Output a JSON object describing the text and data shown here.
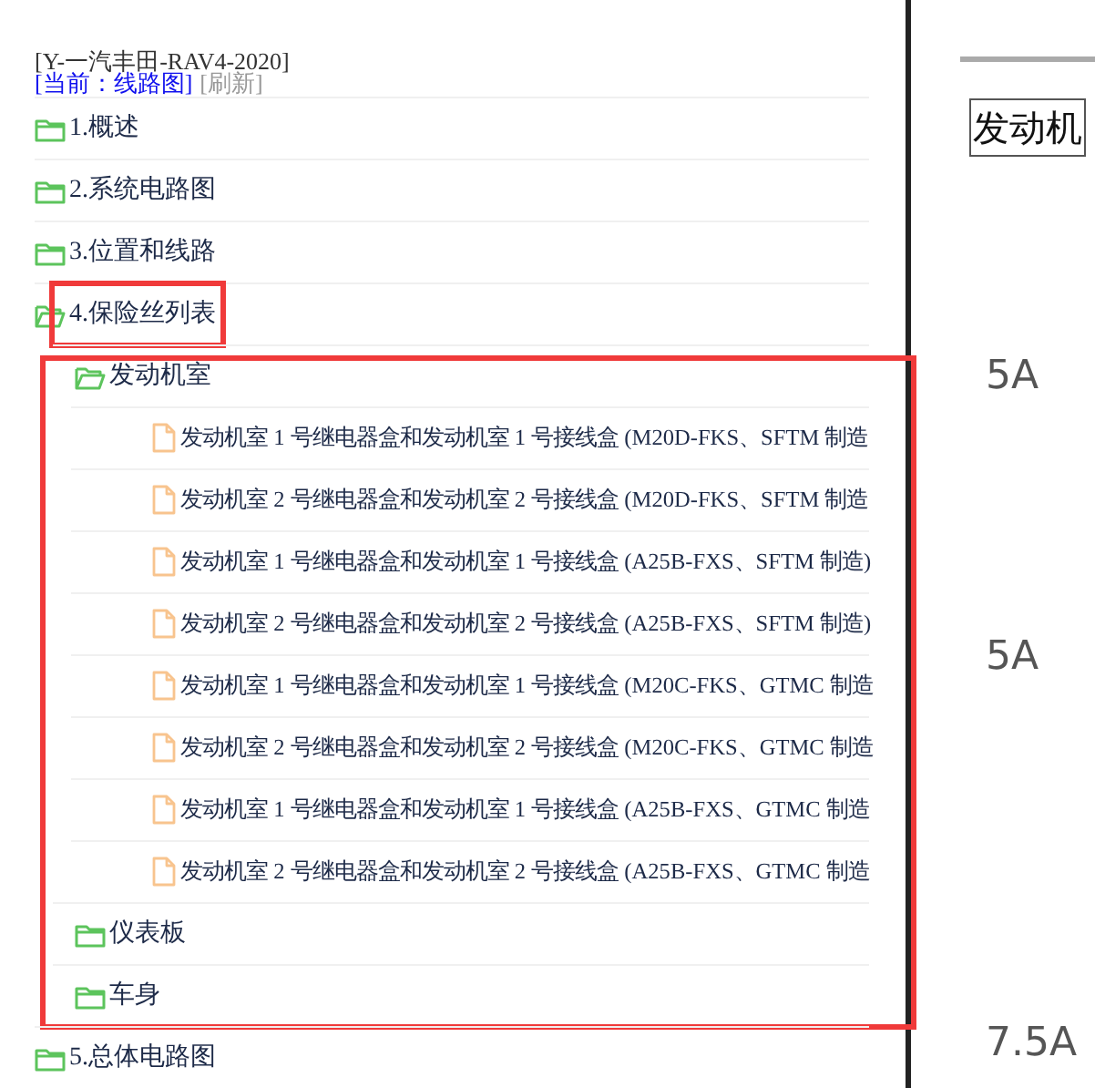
{
  "header": {
    "title": "[Y-一汽丰田-RAV4-2020]",
    "current": "[当前：线路图]",
    "refresh": "[刷新]"
  },
  "tree": [
    {
      "label": "1.概述",
      "kind": "folder",
      "expanded": false,
      "highlighted": false
    },
    {
      "label": "2.系统电路图",
      "kind": "folder",
      "expanded": false,
      "highlighted": false
    },
    {
      "label": "3.位置和线路",
      "kind": "folder",
      "expanded": false,
      "highlighted": false
    },
    {
      "label": "4.保险丝列表",
      "kind": "folder",
      "expanded": true,
      "highlighted": true,
      "children": [
        {
          "label": "发动机室",
          "kind": "folder",
          "expanded": true,
          "highlighted": false,
          "children": [
            {
              "label": "发动机室 1 号继电器盒和发动机室 1 号接线盒 (M20D-FKS、SFTM 制造",
              "kind": "file"
            },
            {
              "label": "发动机室 2 号继电器盒和发动机室 2 号接线盒 (M20D-FKS、SFTM 制造",
              "kind": "file"
            },
            {
              "label": "发动机室 1 号继电器盒和发动机室 1 号接线盒 (A25B-FXS、SFTM 制造)",
              "kind": "file"
            },
            {
              "label": "发动机室 2 号继电器盒和发动机室 2 号接线盒 (A25B-FXS、SFTM 制造)",
              "kind": "file"
            },
            {
              "label": "发动机室 1 号继电器盒和发动机室 1 号接线盒 (M20C-FKS、GTMC 制造",
              "kind": "file"
            },
            {
              "label": "发动机室 2 号继电器盒和发动机室 2 号接线盒 (M20C-FKS、GTMC 制造",
              "kind": "file"
            },
            {
              "label": "发动机室 1 号继电器盒和发动机室 1 号接线盒 (A25B-FXS、GTMC 制造",
              "kind": "file"
            },
            {
              "label": "发动机室 2 号继电器盒和发动机室 2 号接线盒 (A25B-FXS、GTMC 制造",
              "kind": "file"
            }
          ]
        },
        {
          "label": "仪表板",
          "kind": "folder",
          "expanded": false,
          "highlighted": false
        },
        {
          "label": "车身",
          "kind": "folder",
          "expanded": false,
          "highlighted": false
        }
      ]
    },
    {
      "label": "5.总体电路图",
      "kind": "folder",
      "expanded": false,
      "highlighted": false
    }
  ],
  "detail": {
    "section": "发动机",
    "ratings": [
      "5A",
      "5A",
      "7.5A"
    ]
  }
}
